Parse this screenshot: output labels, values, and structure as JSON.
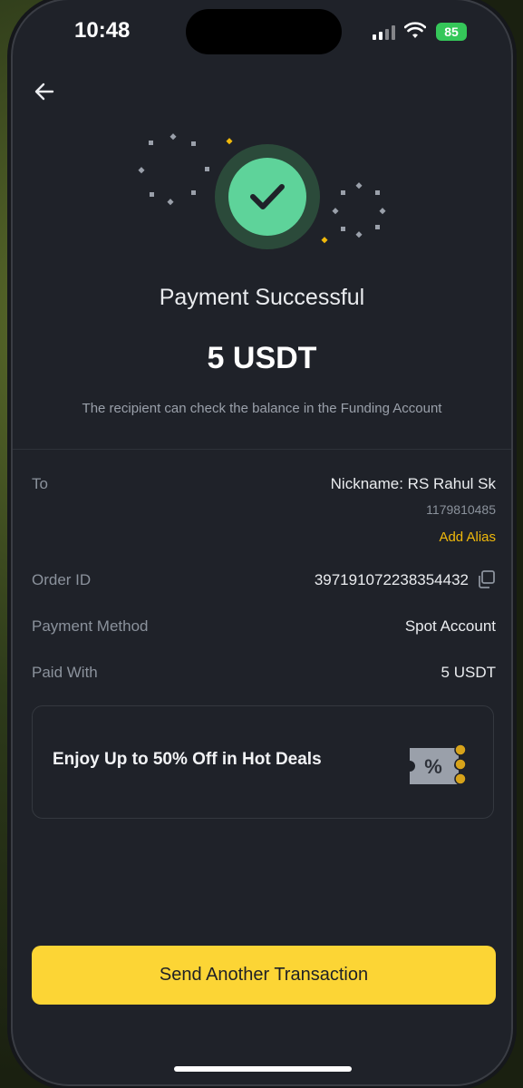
{
  "status_bar": {
    "time": "10:48",
    "battery": "85"
  },
  "header": {
    "back_icon": "arrow-left-icon"
  },
  "result": {
    "icon": "check-icon",
    "title": "Payment Successful",
    "amount": "5 USDT",
    "note": "The recipient can check the balance in the Funding Account"
  },
  "details": {
    "to_label": "To",
    "to_nickname": "Nickname: RS Rahul Sk",
    "to_id": "1179810485",
    "add_alias": "Add Alias",
    "order_label": "Order ID",
    "order_value": "397191072238354432",
    "method_label": "Payment Method",
    "method_value": "Spot Account",
    "paid_label": "Paid With",
    "paid_value": "5 USDT"
  },
  "promo": {
    "text": "Enjoy Up to 50% Off in Hot Deals",
    "icon": "coupon-icon"
  },
  "cta": {
    "label": "Send Another Transaction"
  },
  "colors": {
    "accent": "#fcd535",
    "success": "#5ed39a",
    "background": "#1f2229",
    "alias": "#f0b90b"
  }
}
